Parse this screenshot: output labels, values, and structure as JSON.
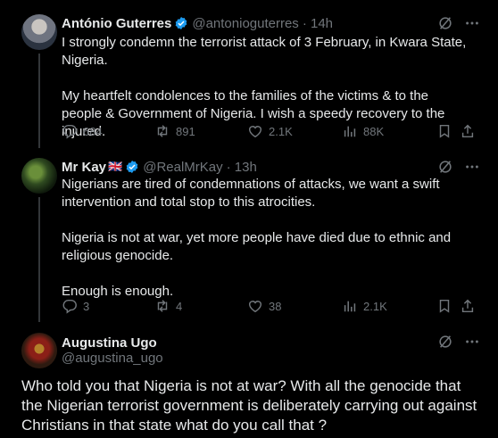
{
  "tweets": [
    {
      "name": "António Guterres",
      "handle": "@antonioguterres",
      "time": "· 14h",
      "paragraphs": [
        "I strongly condemn the terrorist attack of 3 February, in Kwara State, Nigeria.",
        "My heartfelt condolences to the families of the victims & to the people & Government of Nigeria. I wish a speedy recovery to the injured."
      ],
      "stats": {
        "replies": "684",
        "reposts": "891",
        "likes": "2.1K",
        "views": "88K"
      }
    },
    {
      "name": "Mr Kay",
      "flag": "🇬🇧",
      "handle": "@RealMrKay",
      "time": "· 13h",
      "paragraphs": [
        "Nigerians are tired of condemnations of attacks, we want a swift intervention and total stop to this atrocities.",
        "Nigeria is not at war, yet more people have died due to ethnic and religious genocide.",
        "Enough is enough."
      ],
      "stats": {
        "replies": "3",
        "reposts": "4",
        "likes": "38",
        "views": "2.1K"
      }
    },
    {
      "name": "Augustina Ugo",
      "handle": "@augustina_ugo",
      "body": "Who told you that Nigeria is not at war? With all the genocide that the Nigerian terrorist government is deliberately carrying out against Christians in that state what do you call that ?"
    }
  ],
  "icons": {
    "verified": "verified-badge-icon",
    "grok": "grok-icon",
    "more": "more-icon",
    "reply": "reply-icon",
    "repost": "repost-icon",
    "like": "like-icon",
    "views": "views-icon",
    "bookmark": "bookmark-icon",
    "share": "share-icon"
  },
  "colors": {
    "background": "#000000",
    "text": "#e7e9ea",
    "muted": "#71767b",
    "verified": "#1d9bf0"
  }
}
